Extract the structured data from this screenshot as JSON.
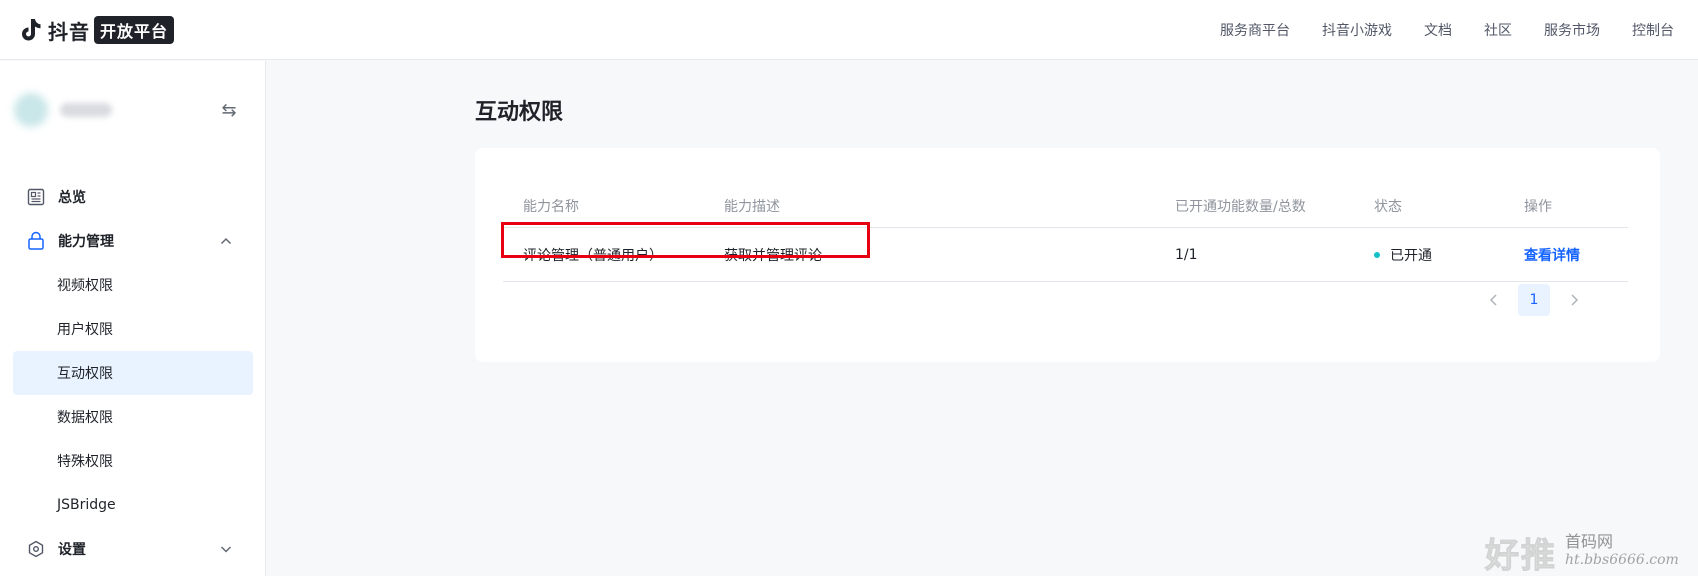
{
  "header": {
    "brand": "抖音",
    "badge": "开放平台",
    "nav": [
      "服务商平台",
      "抖音小游戏",
      "文档",
      "社区",
      "服务市场",
      "控制台"
    ]
  },
  "sidebar": {
    "menu": {
      "overview": "总览",
      "capability": "能力管理",
      "subitems": [
        "视频权限",
        "用户权限",
        "互动权限",
        "数据权限",
        "特殊权限",
        "JSBridge"
      ],
      "active_subitem": "互动权限",
      "settings": "设置"
    }
  },
  "page": {
    "title": "互动权限"
  },
  "table": {
    "columns": [
      "能力名称",
      "能力描述",
      "已开通功能数量/总数",
      "状态",
      "操作"
    ],
    "rows": [
      {
        "name": "评论管理（普通用户）",
        "desc": "获取并管理评论",
        "count": "1/1",
        "status": "已开通",
        "action": "查看详情"
      }
    ]
  },
  "pagination": {
    "current": "1"
  },
  "watermark": {
    "big": "好推",
    "line1": "首码网",
    "line2": "ht.bbs6666.com"
  },
  "colors": {
    "accent": "#1664ff",
    "status_dot": "#14c0c6",
    "highlight_box": "#e60012",
    "active_bg": "#e8f3ff"
  }
}
